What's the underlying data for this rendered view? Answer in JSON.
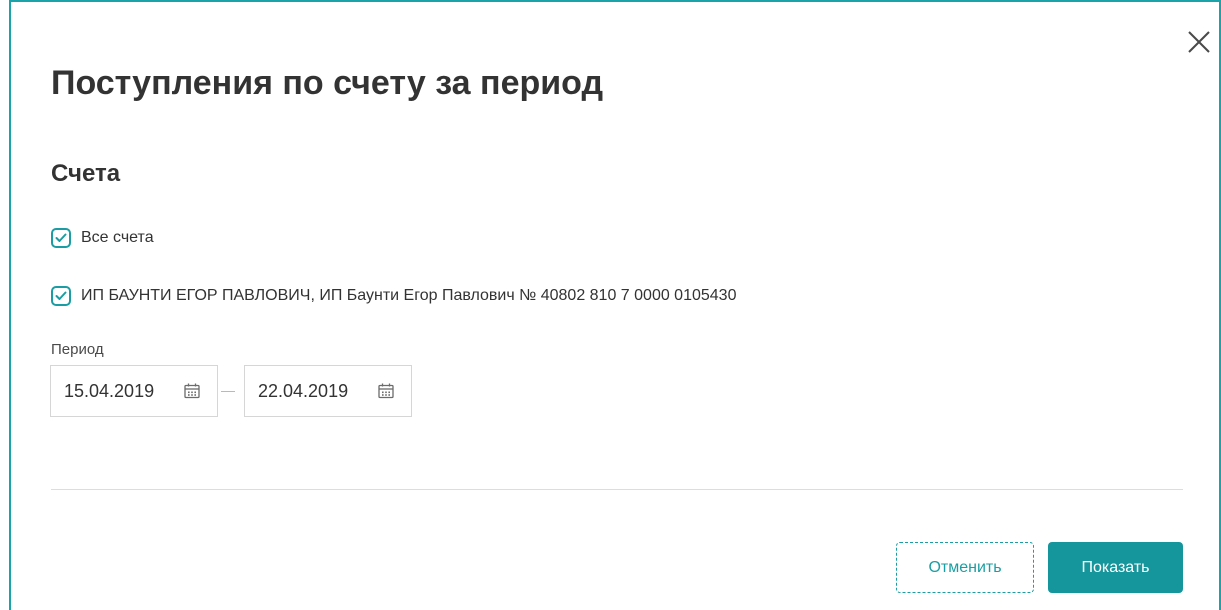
{
  "dialog": {
    "title": "Поступления по счету за период",
    "close_icon": "close-icon"
  },
  "accounts": {
    "section_title": "Счета",
    "items": [
      {
        "label": "Все счета",
        "checked": true
      },
      {
        "label": "ИП БАУНТИ ЕГОР ПАВЛОВИЧ, ИП Баунти Егор Павлович № 40802 810 7 0000 0105430",
        "checked": true
      }
    ]
  },
  "period": {
    "label": "Период",
    "from": "15.04.2019",
    "to": "22.04.2019",
    "calendar_icon": "calendar-icon"
  },
  "actions": {
    "cancel_label": "Отменить",
    "show_label": "Показать"
  },
  "colors": {
    "accent": "#1a9ea3",
    "primary_button": "#14969c",
    "border": "#1aa3a8",
    "text": "#333333"
  }
}
